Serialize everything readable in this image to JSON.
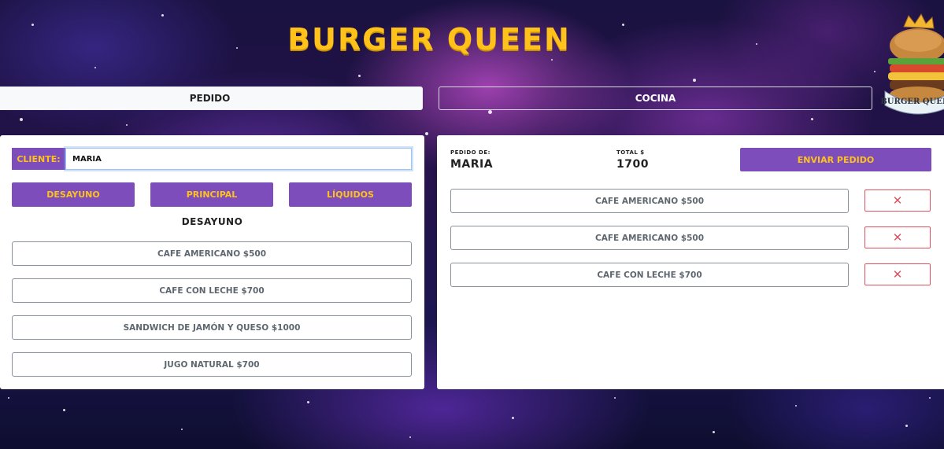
{
  "app": {
    "title": "BURGER QUEEN",
    "logo_text": "BURGER QUEEN"
  },
  "tabs": {
    "pedido": "PEDIDO",
    "cocina": "COCINA"
  },
  "order_form": {
    "client_label": "CLIENTE:",
    "client_value": "MARIA",
    "categories": [
      "DESAYUNO",
      "PRINCIPAL",
      "LÍQUIDOS"
    ],
    "section_title": "DESAYUNO",
    "items": [
      "CAFE AMERICANO $500",
      "CAFE CON LECHE $700",
      "SANDWICH DE JAMÓN Y QUESO $1000",
      "JUGO NATURAL $700"
    ]
  },
  "summary": {
    "pedido_de_label": "PEDIDO DE:",
    "pedido_de_value": "MARIA",
    "total_label": "TOTAL $",
    "total_value": "1700",
    "send_button": "ENVIAR PEDIDO",
    "order_items": [
      "CAFE AMERICANO $500",
      "CAFE AMERICANO $500",
      "CAFE CON LECHE $700"
    ],
    "delete_symbol": "✕"
  },
  "colors": {
    "accent_purple": "#7c4dbb",
    "accent_yellow": "#ffc21a",
    "delete_red": "#e0525f"
  }
}
